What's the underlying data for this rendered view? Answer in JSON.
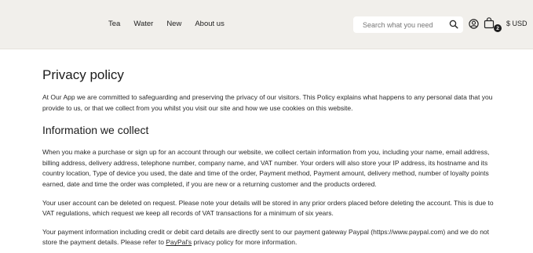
{
  "header": {
    "nav": [
      "Tea",
      "Water",
      "New",
      "About us"
    ],
    "search_placeholder": "Search what you need",
    "cart_count": "2",
    "currency": "$ USD"
  },
  "page": {
    "title": "Privacy policy",
    "intro": "At Our App we are committed to safeguarding and preserving the privacy of our visitors. This Policy explains what happens to any personal data that you provide to us, or that we collect from you whilst you visit our site and how we use cookies on this website.",
    "section_title": "Information we collect",
    "paragraph1": "When you make a purchase or sign up for an account through our website, we collect certain information from you, including your name, email address, billing address, delivery address, telephone number, company name, and VAT number. Your orders will also store your IP address, its hostname and its country location, Type of device you used, the date and time of the order, Payment method, Payment amount, delivery method, number of loyalty points earned, date and time the order was completed, if you are new or a returning customer and the products ordered.",
    "paragraph2": "Your user account can be deleted on request. Please note your details will be stored in any prior orders placed before deleting the account. This is due to VAT regulations, which request we keep all records of VAT transactions for a minimum of six years.",
    "paragraph3_before": "Your payment information including credit or debit card details are directly sent to our payment gateway Paypal (https://www.paypal.com) and we do not store the payment details. Please refer to ",
    "paragraph3_link": "PayPal's",
    "paragraph3_after": " privacy policy for more information."
  }
}
